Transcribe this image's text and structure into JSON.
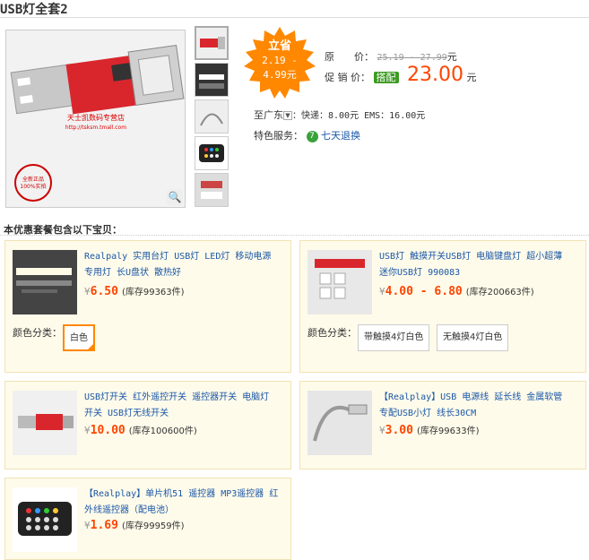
{
  "title": "USB灯全套2",
  "burst": {
    "line1": "立省",
    "line2": "2.19 -",
    "line3": "4.99元"
  },
  "price": {
    "orig_label": "原　　价：",
    "orig_value": "25.19 - 27.99",
    "orig_unit": "元",
    "sale_label": "促 销 价：",
    "badge": "搭配",
    "sale_value": "23.00",
    "sale_unit": "元"
  },
  "shipping": {
    "to": "至广东",
    "dropdown": "▼",
    "text": "：快递：8.00元 EMS：16.00元"
  },
  "service": {
    "label": "特色服务：",
    "icon": "7",
    "link": "七天退换"
  },
  "package_heading": "本优惠套餐包含以下宝贝：",
  "products": [
    {
      "name_line1": "Realpaly 实用台灯 USB灯 LED灯 移动电源",
      "name_line2": "专用灯 长U盘状 散热好",
      "yen": "¥",
      "price": "6.50",
      "stock": "(库存99363件)",
      "color_label": "颜色分类：",
      "options": [
        "白色"
      ]
    },
    {
      "name_line1": "USB灯 触摸开关USB灯 电脑键盘灯 超小超薄",
      "name_line2": "迷你USB灯 990083",
      "yen": "¥",
      "price": "4.00 - 6.80",
      "stock": "(库存200663件)",
      "color_label": "颜色分类：",
      "options": [
        "带触摸4灯白色",
        "无触摸4灯白色"
      ]
    },
    {
      "name_line1": "USB灯开关 红外遥控开关 遥控器开关 电脑灯",
      "name_line2": "开关 USB灯无线开关",
      "yen": "¥",
      "price": "10.00",
      "stock": "(库存100600件)"
    },
    {
      "name_line1": "【Realplay】USB 电源线 延长线 金属软管",
      "name_line2": "专配USB小灯 线长30CM",
      "yen": "¥",
      "price": "3.00",
      "stock": "(库存99633件)"
    },
    {
      "name_line1": "【Realplay】单片机51 遥控器 MP3遥控器 红",
      "name_line2": "外线遥控器（配电池）",
      "yen": "¥",
      "price": "1.69",
      "stock": "(库存99959件)"
    }
  ],
  "main_image_text": {
    "shop": "天士凯数码专营店",
    "url": "http://tsksm.tmall.com",
    "stamp_1": "全新正品",
    "stamp_2": "100%实拍"
  },
  "colors": {
    "sale": "#ff4400",
    "burst": "#ff8800",
    "link": "#1a57a8",
    "card_bg": "#fffbea",
    "badge": "#3c9a21"
  }
}
